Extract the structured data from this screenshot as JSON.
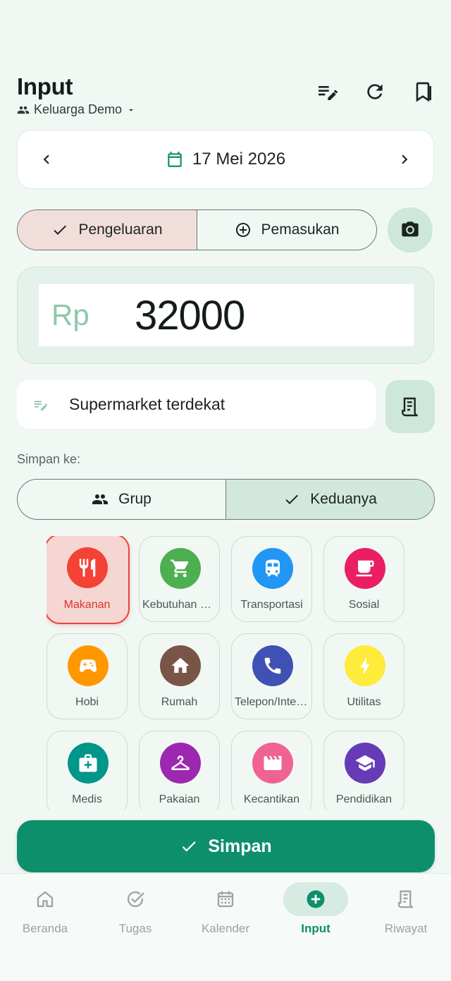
{
  "header": {
    "title": "Input",
    "group_name": "Keluarga Demo",
    "icons": [
      "edit-list-icon",
      "refresh-icon",
      "bookmarks-icon"
    ]
  },
  "date": {
    "value": "17 Mei 2026"
  },
  "type_toggle": {
    "expense_label": "Pengeluaran",
    "income_label": "Pemasukan",
    "selected": "Pengeluaran"
  },
  "amount": {
    "currency": "Rp",
    "value": "32000"
  },
  "note": {
    "value": "Supermarket terdekat"
  },
  "destination": {
    "label": "Simpan ke:",
    "group_label": "Grup",
    "both_label": "Keduanya",
    "selected": "Keduanya"
  },
  "categories": [
    {
      "label": "Makanan",
      "icon": "restaurant-icon",
      "color": "#f44336",
      "selected": true
    },
    {
      "label": "Kebutuhan Rumah Tangga",
      "icon": "cart-icon",
      "color": "#4caf50"
    },
    {
      "label": "Transportasi",
      "icon": "train-icon",
      "color": "#2196f3"
    },
    {
      "label": "Sosial",
      "icon": "coffee-icon",
      "color": "#e91e63"
    },
    {
      "label": "Hobi",
      "icon": "gamepad-icon",
      "color": "#ff9800"
    },
    {
      "label": "Rumah",
      "icon": "home-icon",
      "color": "#795548"
    },
    {
      "label": "Telepon/Internet",
      "icon": "phone-icon",
      "color": "#3f51b5"
    },
    {
      "label": "Utilitas",
      "icon": "bolt-icon",
      "color": "#ffeb3b"
    },
    {
      "label": "Medis",
      "icon": "medical-kit-icon",
      "color": "#009688"
    },
    {
      "label": "Pakaian",
      "icon": "hanger-icon",
      "color": "#9c27b0"
    },
    {
      "label": "Kecantikan",
      "icon": "clapperboard-icon",
      "color": "#f06292"
    },
    {
      "label": "Pendidikan",
      "icon": "graduation-cap-icon",
      "color": "#673ab7"
    }
  ],
  "save_button": {
    "label": "Simpan"
  },
  "bottom_nav": [
    {
      "label": "Beranda",
      "icon": "home-outline-icon"
    },
    {
      "label": "Tugas",
      "icon": "check-circle-icon"
    },
    {
      "label": "Kalender",
      "icon": "calendar-icon"
    },
    {
      "label": "Input",
      "icon": "add-circle-icon",
      "active": true
    },
    {
      "label": "Riwayat",
      "icon": "receipt-icon"
    }
  ],
  "colors": {
    "primary": "#0e8f6b",
    "background": "#f1f8f4",
    "expense_active": "#f1dedb",
    "selected_border": "#e8453c"
  }
}
